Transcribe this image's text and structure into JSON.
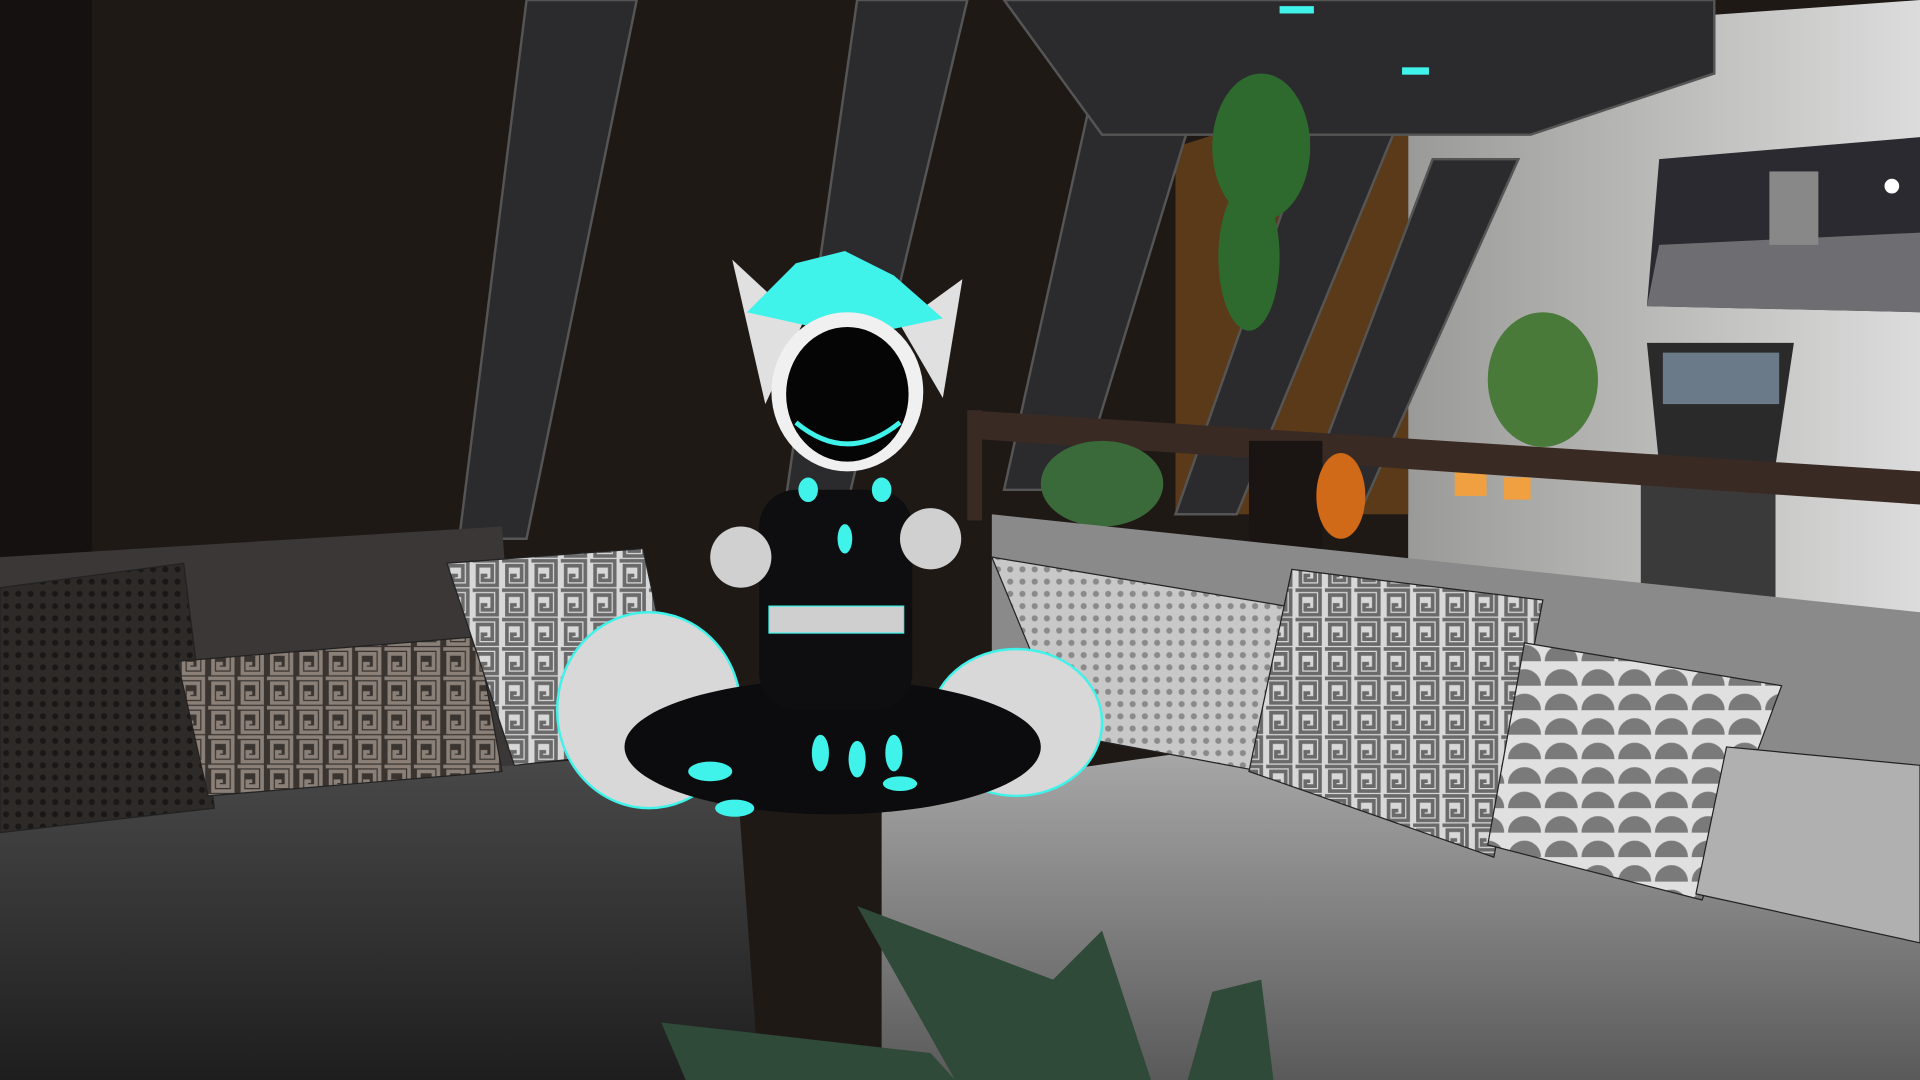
{
  "scene": {
    "type": "vr-social-world-room",
    "colors": {
      "accent_glow": "#3ff2ea",
      "dark_wall": "#1f1916",
      "light_wall": "#cfcfcf",
      "sofa_dark": "#3a3a3a",
      "sofa_light": "#8f8f8f",
      "plant": "#2f5a3a"
    },
    "objects": [
      "ceiling-beams",
      "hanging-plant",
      "wall-poster-moon",
      "arcade-kiosk",
      "railing",
      "left-sofa",
      "right-sofa",
      "pillows",
      "avatar",
      "foreground-plant"
    ]
  }
}
